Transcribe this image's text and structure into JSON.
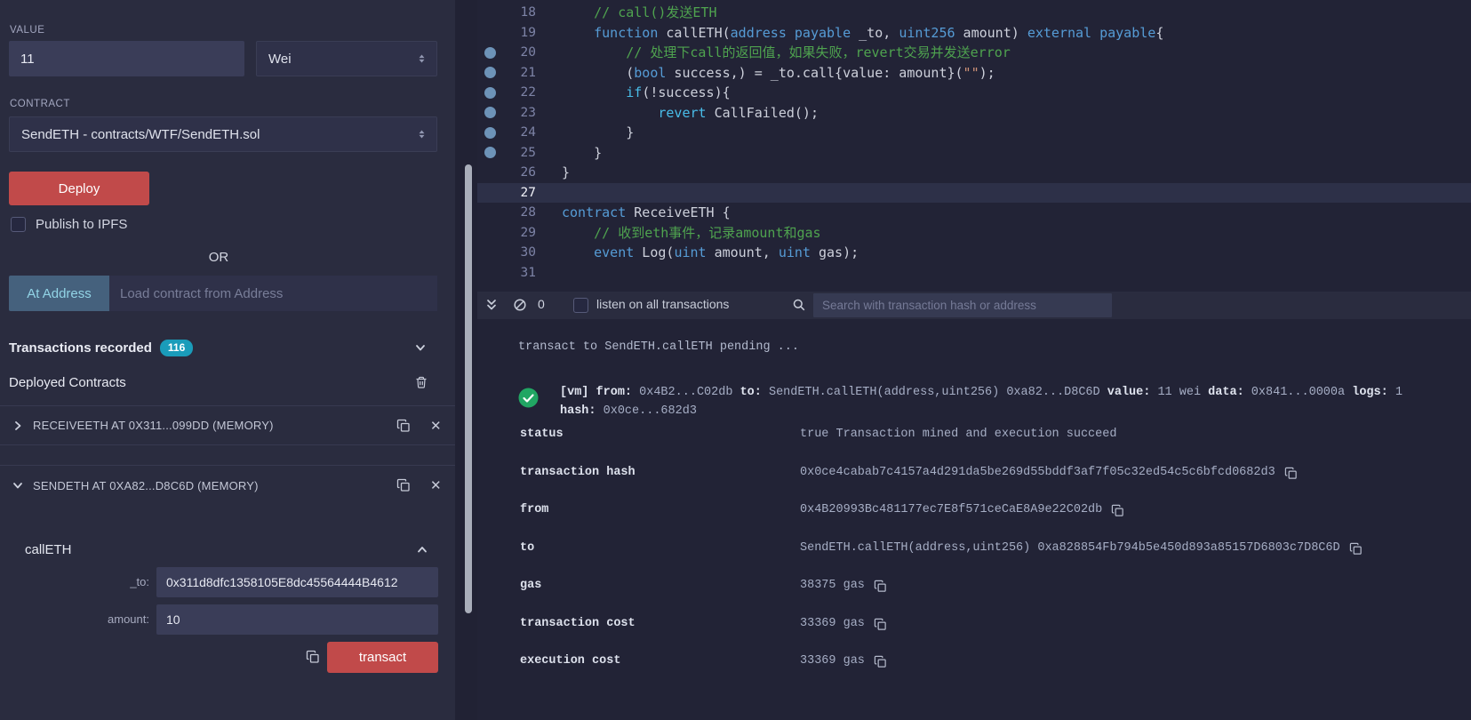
{
  "icons": {
    "close": "✕"
  },
  "colors": {
    "danger_red": "#c14a4a",
    "badge_teal": "#1a9cba",
    "success_green": "#21a663",
    "keyword_blue": "#569cd6",
    "comment_green": "#4fa34f"
  },
  "left_panel": {
    "value": {
      "label": "VALUE",
      "amount": "11",
      "unit": "Wei"
    },
    "contract": {
      "label": "CONTRACT",
      "selected": "SendETH - contracts/WTF/SendETH.sol"
    },
    "deploy_button": "Deploy",
    "publish_ipfs_label": "Publish to IPFS",
    "or_label": "OR",
    "at_address_button": "At Address",
    "at_address_placeholder": "Load contract from Address",
    "transactions_recorded_label": "Transactions recorded",
    "transactions_count": "116",
    "deployed_contracts_label": "Deployed Contracts",
    "instances": [
      {
        "title": "RECEIVEETH AT 0X311...099DD (MEMORY)"
      },
      {
        "title": "SENDETH AT 0XA82...D8C6D (MEMORY)"
      }
    ],
    "function_panel": {
      "name": "callETH",
      "fields": [
        {
          "label": "_to:",
          "value": "0x311d8dfc1358105E8dc45564444B4612"
        },
        {
          "label": "amount:",
          "value": "10"
        }
      ],
      "transact_button": "transact"
    }
  },
  "editor": {
    "lines": [
      {
        "num": "18",
        "dot": false,
        "current": false,
        "tokens": [
          [
            "t",
            "    "
          ],
          [
            "c",
            "// call()发送ETH"
          ]
        ]
      },
      {
        "num": "19",
        "dot": false,
        "current": false,
        "tokens": [
          [
            "t",
            "    "
          ],
          [
            "k",
            "function"
          ],
          [
            "t",
            " callETH("
          ],
          [
            "k",
            "address"
          ],
          [
            "t",
            " "
          ],
          [
            "k",
            "payable"
          ],
          [
            "t",
            " _to, "
          ],
          [
            "k",
            "uint256"
          ],
          [
            "t",
            " amount) "
          ],
          [
            "k",
            "external"
          ],
          [
            "t",
            " "
          ],
          [
            "k",
            "payable"
          ],
          [
            "t",
            "{"
          ]
        ]
      },
      {
        "num": "20",
        "dot": true,
        "current": false,
        "tokens": [
          [
            "t",
            "        "
          ],
          [
            "c",
            "// 处理下call的返回值，如果失败，revert交易并发送error"
          ]
        ]
      },
      {
        "num": "21",
        "dot": true,
        "current": false,
        "tokens": [
          [
            "t",
            "        ("
          ],
          [
            "k",
            "bool"
          ],
          [
            "t",
            " success,) = _to.call{value: amount}("
          ],
          [
            "s",
            "\"\""
          ],
          [
            "t",
            ");"
          ]
        ]
      },
      {
        "num": "22",
        "dot": true,
        "current": false,
        "tokens": [
          [
            "t",
            "        "
          ],
          [
            "k2",
            "if"
          ],
          [
            "t",
            "(!success){"
          ]
        ]
      },
      {
        "num": "23",
        "dot": true,
        "current": false,
        "tokens": [
          [
            "t",
            "            "
          ],
          [
            "k2",
            "revert"
          ],
          [
            "t",
            " CallFailed();"
          ]
        ]
      },
      {
        "num": "24",
        "dot": true,
        "current": false,
        "tokens": [
          [
            "t",
            "        }"
          ]
        ]
      },
      {
        "num": "25",
        "dot": true,
        "current": false,
        "tokens": [
          [
            "t",
            "    }"
          ]
        ]
      },
      {
        "num": "26",
        "dot": false,
        "current": false,
        "tokens": [
          [
            "t",
            "}"
          ]
        ]
      },
      {
        "num": "27",
        "dot": false,
        "current": true,
        "tokens": []
      },
      {
        "num": "28",
        "dot": false,
        "current": false,
        "tokens": [
          [
            "k",
            "contract"
          ],
          [
            "t",
            " ReceiveETH {"
          ]
        ]
      },
      {
        "num": "29",
        "dot": false,
        "current": false,
        "tokens": [
          [
            "t",
            "    "
          ],
          [
            "c",
            "// 收到eth事件，记录amount和gas"
          ]
        ]
      },
      {
        "num": "30",
        "dot": false,
        "current": false,
        "tokens": [
          [
            "t",
            "    "
          ],
          [
            "k",
            "event"
          ],
          [
            "t",
            " Log("
          ],
          [
            "k",
            "uint"
          ],
          [
            "t",
            " amount, "
          ],
          [
            "k",
            "uint"
          ],
          [
            "t",
            " gas);"
          ]
        ]
      },
      {
        "num": "31",
        "dot": false,
        "current": false,
        "tokens": []
      }
    ]
  },
  "terminal": {
    "toolbar": {
      "count": "0",
      "listen_label": "listen on all transactions",
      "search_placeholder": "Search with transaction hash or address"
    },
    "pending_line": "transact to SendETH.callETH pending ... ",
    "summary": [
      [
        "b",
        "[vm]"
      ],
      [
        "t",
        " "
      ],
      [
        "b",
        "from:"
      ],
      [
        "t",
        " 0x4B2...C02db "
      ],
      [
        "b",
        "to:"
      ],
      [
        "t",
        " SendETH.callETH(address,uint256) 0xa82...D8C6D "
      ],
      [
        "b",
        "value:"
      ],
      [
        "t",
        " 11 wei "
      ],
      [
        "b",
        "data:"
      ],
      [
        "t",
        " 0x841...0000a "
      ],
      [
        "b",
        "logs:"
      ],
      [
        "t",
        " 1 "
      ],
      [
        "b",
        "hash:"
      ],
      [
        "t",
        " 0x0ce...682d3"
      ]
    ],
    "rows": [
      {
        "key": "status",
        "value": "true Transaction mined and execution succeed",
        "copy": false
      },
      {
        "key": "transaction hash",
        "value": "0x0ce4cabab7c4157a4d291da5be269d55bddf3af7f05c32ed54c5c6bfcd0682d3",
        "copy": true
      },
      {
        "key": "from",
        "value": "0x4B20993Bc481177ec7E8f571ceCaE8A9e22C02db",
        "copy": true
      },
      {
        "key": "to",
        "value": "SendETH.callETH(address,uint256) 0xa828854Fb794b5e450d893a85157D6803c7D8C6D",
        "copy": true
      },
      {
        "key": "gas",
        "value": "38375 gas",
        "copy": true
      },
      {
        "key": "transaction cost",
        "value": "33369 gas",
        "copy": true
      },
      {
        "key": "execution cost",
        "value": "33369 gas",
        "copy": true
      }
    ]
  }
}
